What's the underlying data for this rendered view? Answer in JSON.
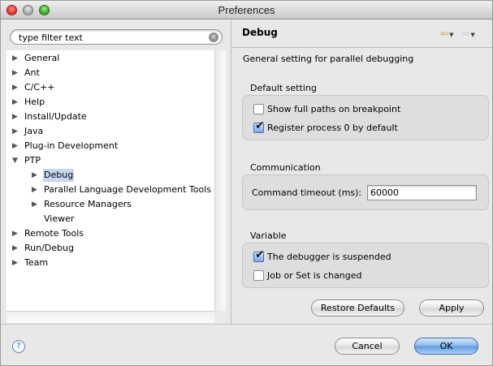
{
  "window": {
    "title": "Preferences"
  },
  "search": {
    "value": "type filter text",
    "clear_icon": "×"
  },
  "tree": [
    {
      "label": "General",
      "expanded": false
    },
    {
      "label": "Ant",
      "expanded": false
    },
    {
      "label": "C/C++",
      "expanded": false
    },
    {
      "label": "Help",
      "expanded": false
    },
    {
      "label": "Install/Update",
      "expanded": false
    },
    {
      "label": "Java",
      "expanded": false
    },
    {
      "label": "Plug-in Development",
      "expanded": false
    },
    {
      "label": "PTP",
      "expanded": true
    },
    {
      "label": "Debug",
      "selected": true
    },
    {
      "label": "Parallel Language Development Tools",
      "expanded": false
    },
    {
      "label": "Resource Managers",
      "expanded": false
    },
    {
      "label": "Viewer"
    },
    {
      "label": "Remote Tools",
      "expanded": false
    },
    {
      "label": "Run/Debug",
      "expanded": false
    },
    {
      "label": "Team",
      "expanded": false
    }
  ],
  "page": {
    "title": "Debug",
    "description": "General setting for parallel debugging",
    "default_setting": {
      "label": "Default setting",
      "show_full_paths": {
        "label": "Show full paths on breakpoint",
        "checked": false
      },
      "register_process": {
        "label": "Register process 0 by default",
        "checked": true
      }
    },
    "communication": {
      "label": "Communication",
      "timeout_label": "Command timeout (ms):",
      "timeout_value": "60000"
    },
    "variable": {
      "label": "Variable",
      "debugger_suspended": {
        "label": "The debugger is suspended",
        "checked": true
      },
      "job_set_changed": {
        "label": "Job or Set is changed",
        "checked": false
      }
    },
    "restore_defaults": "Restore Defaults",
    "apply": "Apply"
  },
  "footer": {
    "help_icon": "?",
    "cancel": "Cancel",
    "ok": "OK"
  },
  "icons": {
    "back": "⇦",
    "forward": "⇨",
    "dropdown": "▼",
    "check": "✔",
    "collapsed": "▶",
    "expanded": "▼"
  }
}
